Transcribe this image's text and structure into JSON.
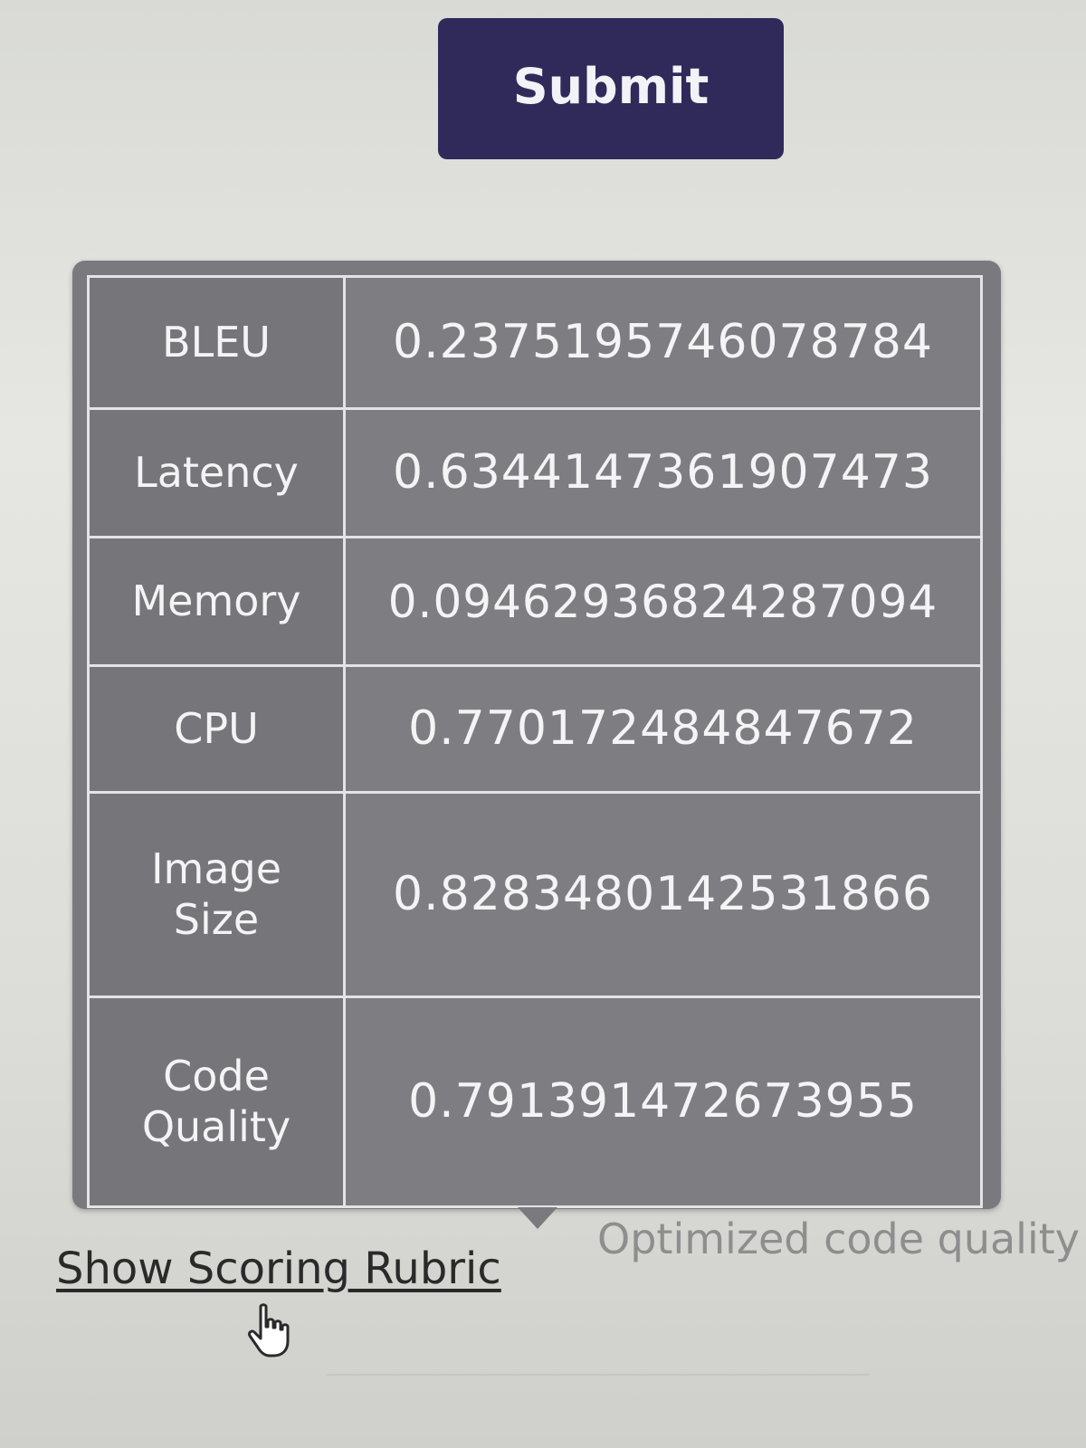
{
  "submit": {
    "label": "Submit"
  },
  "metrics": [
    {
      "label_lines": [
        "BLEU"
      ],
      "value": "0.2375195746078784"
    },
    {
      "label_lines": [
        "Latency"
      ],
      "value": "0.6344147361907473"
    },
    {
      "label_lines": [
        "Memory"
      ],
      "value": "0.09462936824287094"
    },
    {
      "label_lines": [
        "CPU"
      ],
      "value": "0.770172484847672"
    },
    {
      "label_lines": [
        "Image",
        "Size"
      ],
      "value": "0.8283480142531866"
    },
    {
      "label_lines": [
        "Code",
        "Quality"
      ],
      "value": "0.791391472673955"
    }
  ],
  "tooltip_caption": "Optimized code quality",
  "rubric_link": "Show Scoring Rubric",
  "cursor_icon": "hand-pointer-icon",
  "colors": {
    "submit_bg": "#2f2a5a",
    "tooltip_bg": "#7a7a7e",
    "cell_border": "#e4e4e6"
  }
}
